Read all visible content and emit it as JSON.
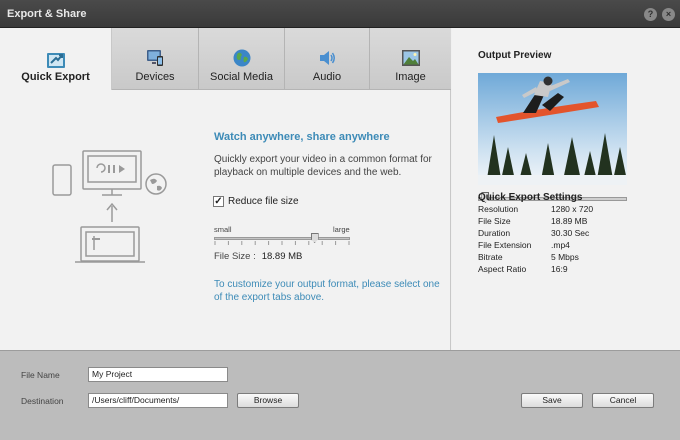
{
  "window": {
    "title": "Export & Share",
    "help_label": "?",
    "close_label": "×"
  },
  "tabs": [
    {
      "label": "Quick Export",
      "icon": "quick-export-icon",
      "active": true
    },
    {
      "label": "Devices",
      "icon": "devices-icon"
    },
    {
      "label": "Social Media",
      "icon": "globe-icon"
    },
    {
      "label": "Audio",
      "icon": "speaker-icon"
    },
    {
      "label": "Image",
      "icon": "image-icon"
    }
  ],
  "quick_export": {
    "headline": "Watch anywhere, share anywhere",
    "description": "Quickly export your video in a common format for playback on multiple devices and the web.",
    "reduce_checkbox": {
      "label": "Reduce file size",
      "checked": true
    },
    "slider": {
      "min_label": "small",
      "max_label": "large",
      "level": 0.74
    },
    "file_size": {
      "label": "File Size :",
      "value": "18.89 MB"
    },
    "customize_hint": "To customize your output format, please select one of the export tabs above."
  },
  "preview": {
    "title": "Output Preview",
    "scrub_level": 0.05
  },
  "settings": {
    "title": "Quick Export Settings",
    "rows": [
      {
        "key": "Resolution",
        "value": "1280 x 720"
      },
      {
        "key": "File Size",
        "value": "18.89 MB"
      },
      {
        "key": "Duration",
        "value": "30.30 Sec"
      },
      {
        "key": "File Extension",
        "value": ".mp4"
      },
      {
        "key": "Bitrate",
        "value": "5 Mbps"
      },
      {
        "key": "Aspect Ratio",
        "value": "16:9"
      }
    ]
  },
  "footer": {
    "file_name_label": "File Name",
    "file_name_value": "My Project",
    "destination_label": "Destination",
    "destination_value": "/Users/cliff/Documents/",
    "browse_label": "Browse",
    "save_label": "Save",
    "cancel_label": "Cancel"
  },
  "colors": {
    "accent": "#3d8bb7",
    "titlebar": "#3a3a3a",
    "footer": "#bcbcbc",
    "panel": "#f2f2f2"
  }
}
